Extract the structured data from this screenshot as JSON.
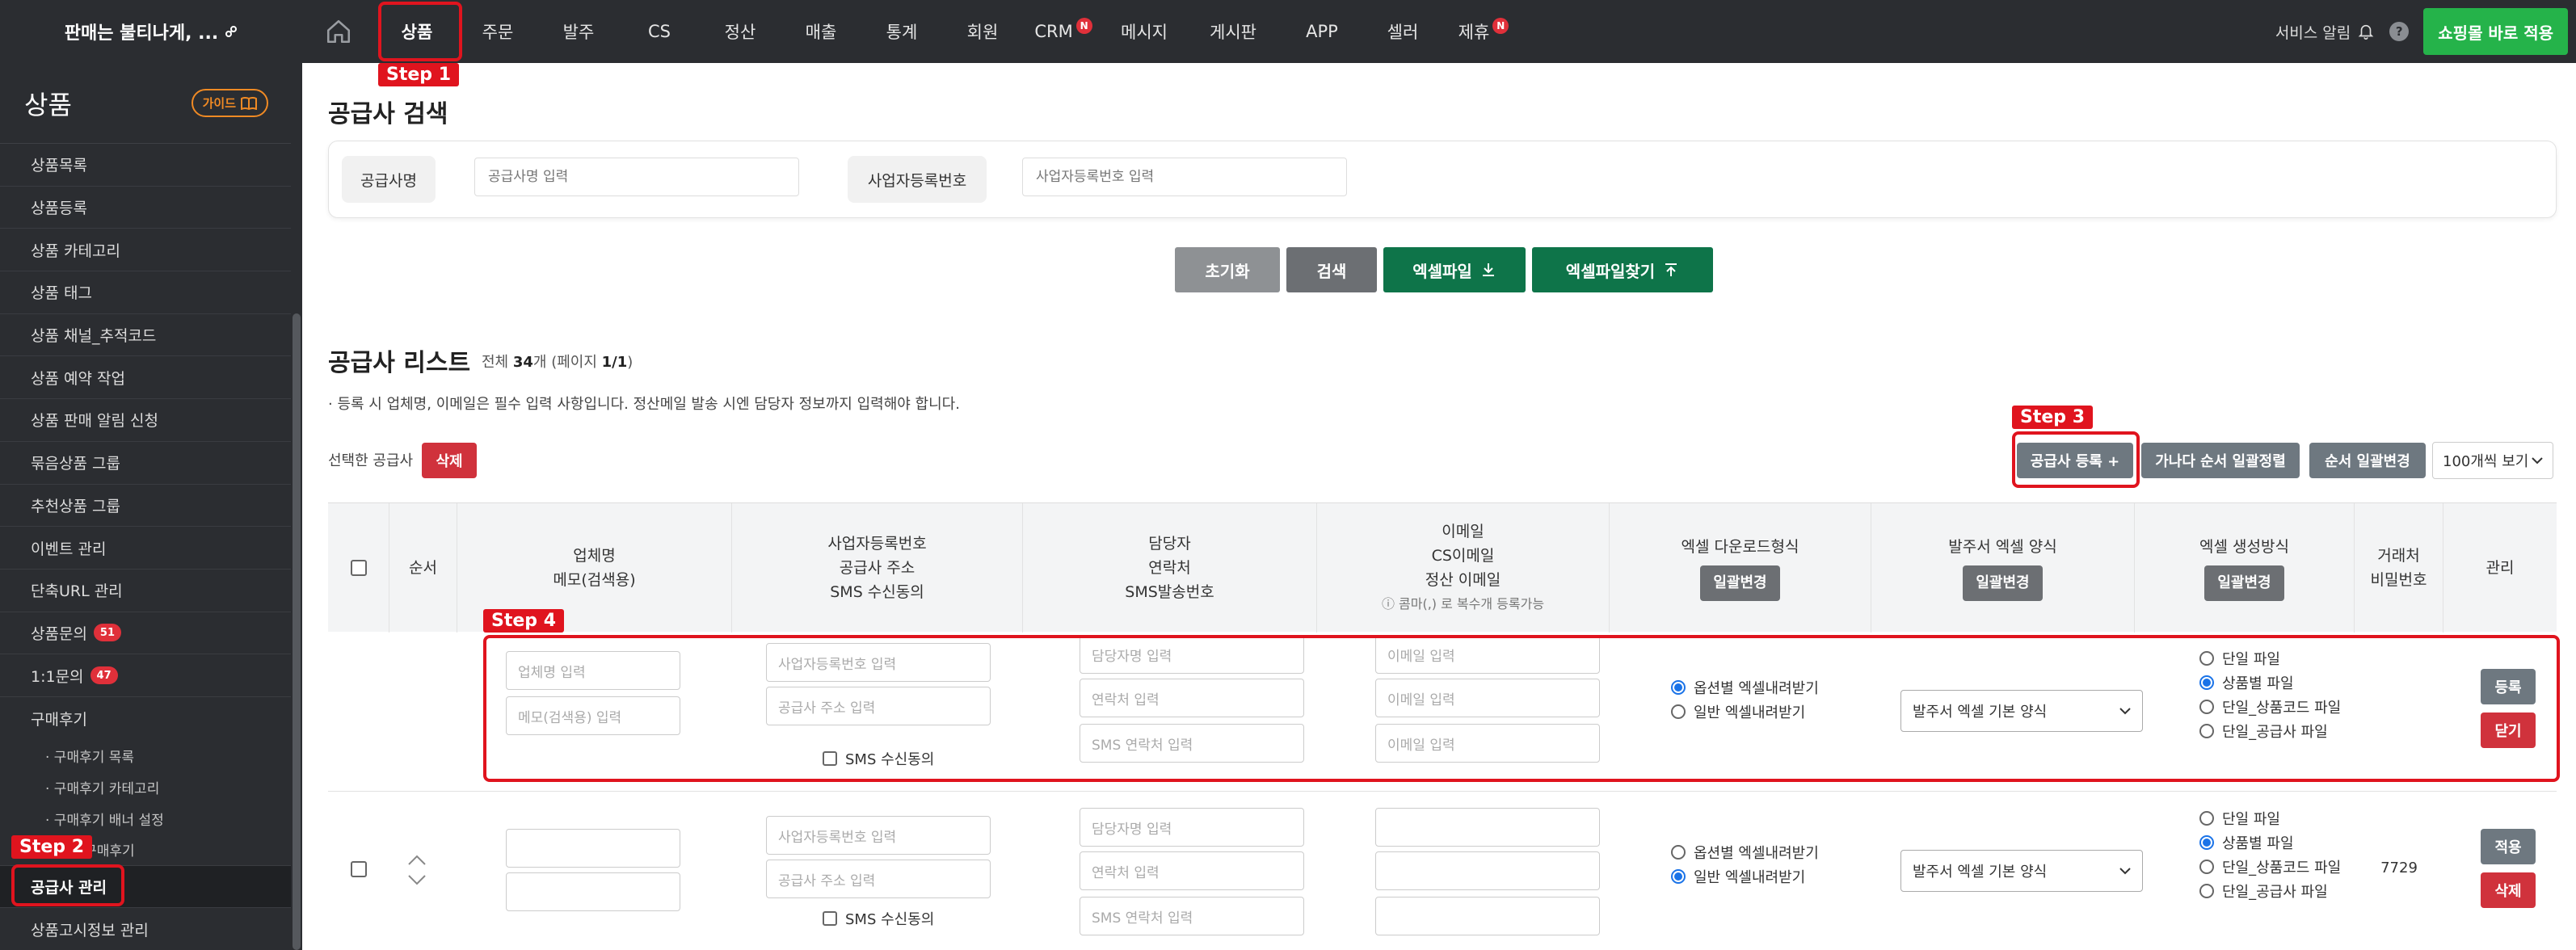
{
  "topbar": {
    "brand": "판매는 불티나게, ...",
    "nav": [
      "상품",
      "주문",
      "발주",
      "CS",
      "정산",
      "매출",
      "통계",
      "회원",
      "CRM",
      "메시지",
      "게시판",
      "APP",
      "셀러",
      "제휴"
    ],
    "new_badge": "N",
    "service_alert": "서비스 알림",
    "help": "?",
    "apply_button": "쇼핑몰 바로 적용"
  },
  "sidebar": {
    "title": "상품",
    "guide": "가이드",
    "items": [
      "상품목록",
      "상품등록",
      "상품 카테고리",
      "상품 태그",
      "상품 채널_추적코드",
      "상품 예약 작업",
      "상품 판매 알림 신청",
      "묶음상품 그룹",
      "추천상품 그룹",
      "이벤트 관리",
      "단축URL 관리",
      "상품문의",
      "1:1문의",
      "구매후기"
    ],
    "counts": {
      "inquiry": "51",
      "one_to_one": "47"
    },
    "sub_items": [
      "· 구매후기 목록",
      "· 구매후기 카테고리",
      "· 구매후기 배너 설정",
      "· ...린 구매후기"
    ],
    "active_item": "공급사 관리",
    "last_item": "상품고시정보 관리"
  },
  "search": {
    "title": "공급사 검색",
    "label_name": "공급사명",
    "placeholder_name": "공급사명 입력",
    "label_biz": "사업자등록번호",
    "placeholder_biz": "사업자등록번호 입력",
    "reset": "초기화",
    "search": "검색",
    "excel_file": "엑셀파일",
    "excel_find": "엑셀파일찾기"
  },
  "list": {
    "title": "공급사 리스트",
    "count_prefix": "전체 ",
    "total": "34",
    "count_suffix": "개 (페이지 ",
    "page": "1/1",
    "count_end": ")",
    "notice": "· 등록 시 업체명, 이메일은 필수 입력 사항입니다. 정산메일 발송 시엔 담당자 정보까지 입력해야 합니다.",
    "selected_label": "선택한 공급사",
    "delete": "삭제",
    "register": "공급사 등록 +",
    "order_sort": "가나다 순서 일괄정렬",
    "order_change": "순서 일괄변경",
    "view_select": "100개씩 보기"
  },
  "table": {
    "headers": {
      "order": "순서",
      "company": [
        "업체명",
        "메모(검색용)"
      ],
      "biz": [
        "사업자등록번호",
        "공급사 주소",
        "SMS 수신동의"
      ],
      "manager": [
        "담당자",
        "연락처",
        "SMS발송번호"
      ],
      "email": [
        "이메일",
        "CS이메일",
        "정산 이메일"
      ],
      "email_note": "ⓘ 콤마(,) 로 복수개 등록가능",
      "excel_download": "엑셀 다운로드형식",
      "po_excel": "발주서 엑셀 양식",
      "excel_gen": "엑셀 생성방식",
      "password": [
        "거래처",
        "비밀번호"
      ],
      "manage": "관리",
      "bulk_change": "일괄변경"
    },
    "placeholders": {
      "company": "업체명 입력",
      "memo": "메모(검색용) 입력",
      "biz": "사업자등록번호 입력",
      "address": "공급사 주소 입력",
      "sms_agree": "SMS 수신동의",
      "manager": "담당자명 입력",
      "phone": "연락처 입력",
      "sms_phone": "SMS 연락처 입력",
      "email": "이메일 입력"
    },
    "download_options": [
      "옵션별 엑셀내려받기",
      "일반 엑셀내려받기"
    ],
    "po_option": "발주서 엑셀 기본 양식",
    "gen_options": [
      "단일 파일",
      "상품별 파일",
      "단일_상품코드 파일",
      "단일_공급사 파일"
    ],
    "new_row": {
      "register": "등록",
      "close": "닫기"
    },
    "row1": {
      "password": "7729",
      "apply": "적용",
      "delete": "삭제"
    }
  },
  "annotations": {
    "step1": "Step 1",
    "step2": "Step 2",
    "step3": "Step 3",
    "step4": "Step 4",
    "color": "#e0141e"
  }
}
